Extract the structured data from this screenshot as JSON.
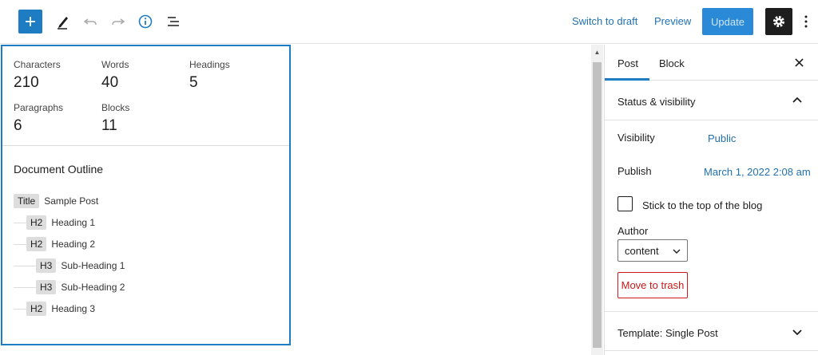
{
  "header": {
    "switch_to_draft": "Switch to draft",
    "preview": "Preview",
    "update": "Update"
  },
  "info": {
    "stats": [
      {
        "label": "Characters",
        "value": "210"
      },
      {
        "label": "Words",
        "value": "40"
      },
      {
        "label": "Headings",
        "value": "5"
      },
      {
        "label": "Paragraphs",
        "value": "6"
      },
      {
        "label": "Blocks",
        "value": "11"
      }
    ],
    "outline_title": "Document Outline",
    "outline": [
      {
        "tag": "Title",
        "text": "Sample Post"
      },
      {
        "tag": "H2",
        "text": "Heading 1"
      },
      {
        "tag": "H2",
        "text": "Heading 2"
      },
      {
        "tag": "H3",
        "text": "Sub-Heading 1"
      },
      {
        "tag": "H3",
        "text": "Sub-Heading 2"
      },
      {
        "tag": "H2",
        "text": "Heading 3"
      }
    ]
  },
  "sidebar": {
    "tab_post": "Post",
    "tab_block": "Block",
    "status_title": "Status & visibility",
    "visibility_label": "Visibility",
    "visibility_value": "Public",
    "publish_label": "Publish",
    "publish_value": "March 1, 2022 2:08 am",
    "sticky_label": "Stick to the top of the blog",
    "author_label": "Author",
    "author_value": "content",
    "trash_label": "Move to trash",
    "template_title": "Template: Single Post"
  },
  "colors": {
    "accent": "#1e7dc2",
    "link": "#2271b1",
    "danger": "#cc1818"
  }
}
